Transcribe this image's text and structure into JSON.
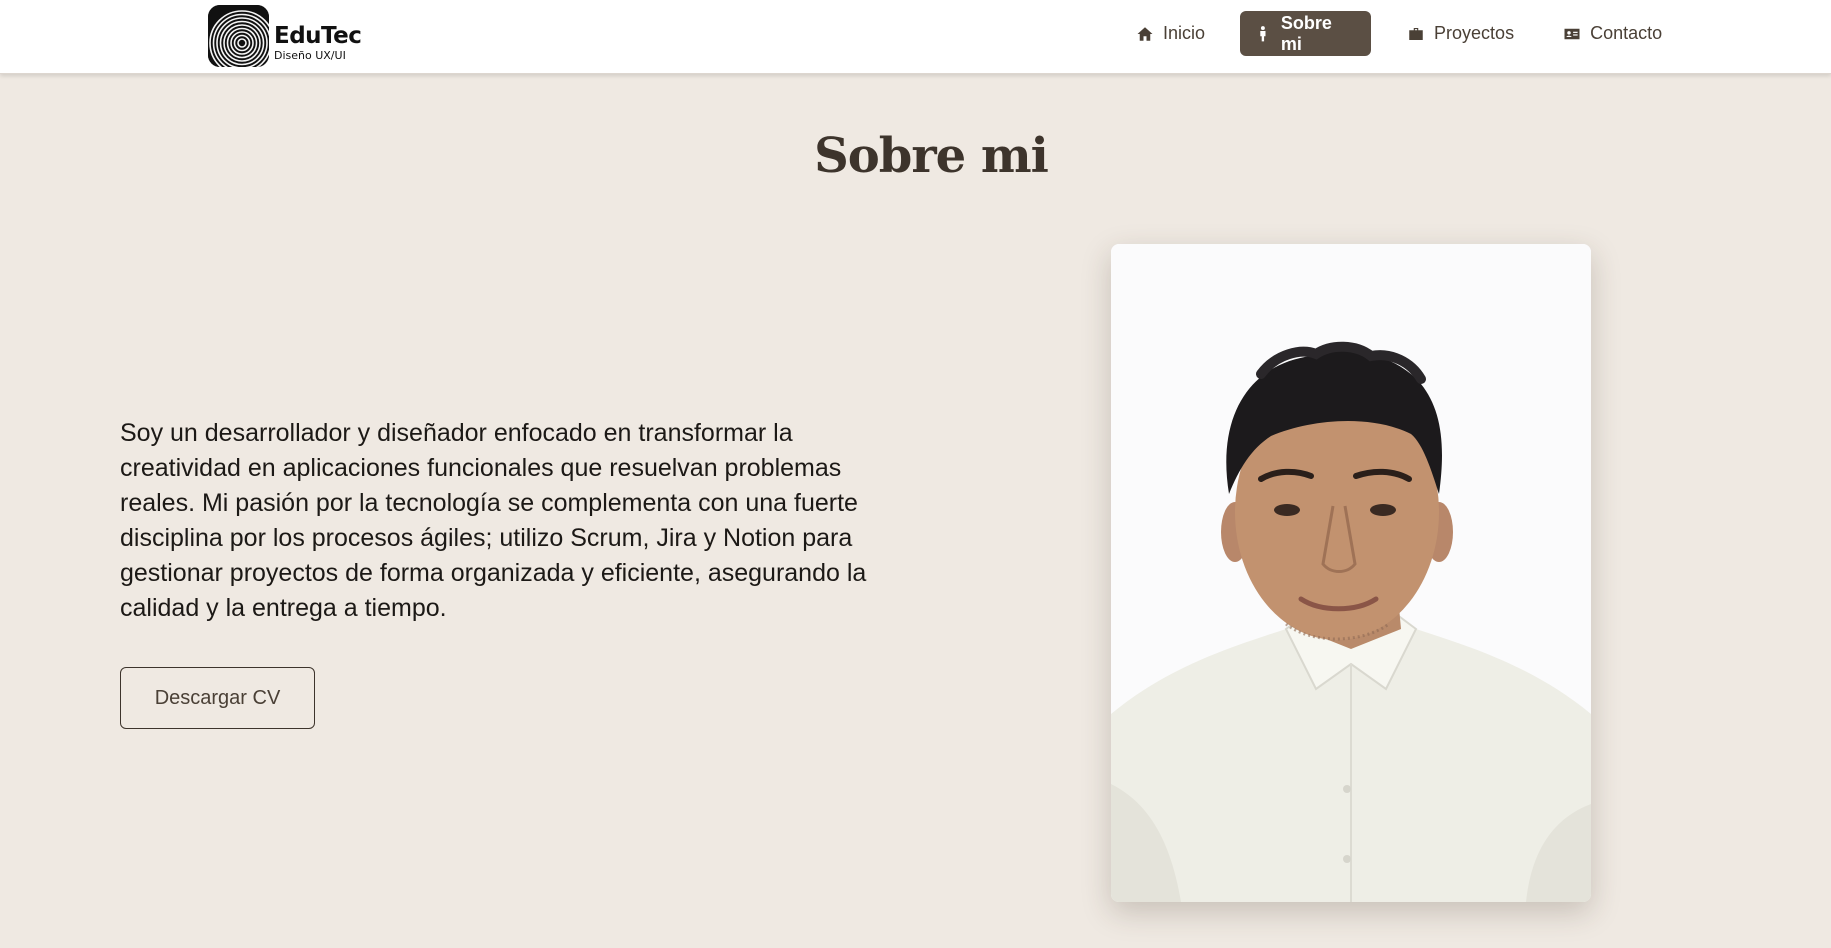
{
  "brand": {
    "name": "EduTec",
    "tagline": "Diseño UX/UI"
  },
  "nav": {
    "items": [
      {
        "label": "Inicio",
        "icon": "home-icon",
        "active": false
      },
      {
        "label": "Sobre mi",
        "icon": "person-icon",
        "active": true
      },
      {
        "label": "Proyectos",
        "icon": "briefcase-icon",
        "active": false
      },
      {
        "label": "Contacto",
        "icon": "contact-card-icon",
        "active": false
      }
    ]
  },
  "about": {
    "title": "Sobre mi",
    "bio": "Soy un desarrollador y diseñador enfocado en transformar la creatividad en aplicaciones funcionales que resuelvan problemas reales. Mi pasión por la tecnología se complementa con una fuerte disciplina por los procesos ágiles; utilizo Scrum, Jira y Notion para gestionar proyectos de forma organizada y eficiente, asegurando la calidad y la entrega a tiempo.",
    "cv_button": "Descargar CV"
  },
  "colors": {
    "background": "#efe9e2",
    "header": "#ffffff",
    "accent": "#5b4f44",
    "title": "#3d342c",
    "text": "#1c1916"
  }
}
